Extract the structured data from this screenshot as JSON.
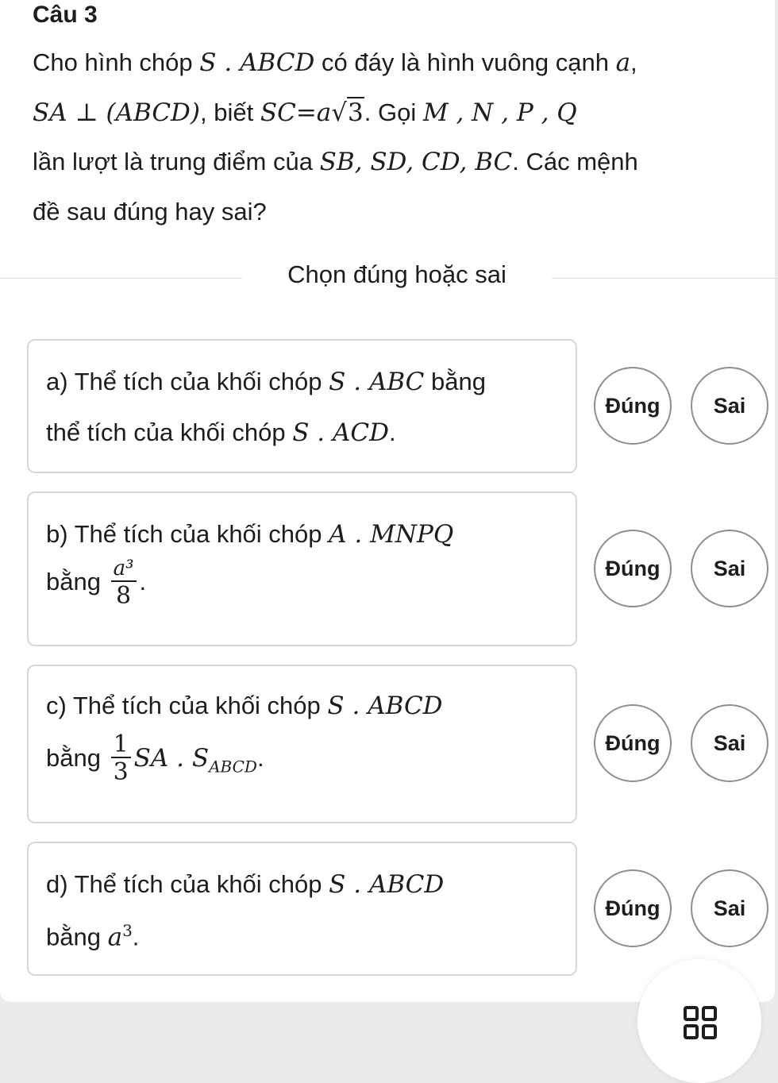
{
  "question": {
    "title": "Câu 3",
    "t_cho": "Cho hình chóp ",
    "t_pyr": "S . ABCD",
    "t_base": " có đáy là hình vuông cạnh ",
    "t_a": "a",
    "t_comma": ",",
    "t_sa": "SA",
    "t_perp": " ⊥ ",
    "t_plane": "(ABCD)",
    "t_biet": ", biết ",
    "t_sc": "SC",
    "t_eq": "=",
    "t_a2": "a",
    "t_sqrt": "√",
    "t_three": "3",
    "t_goi": ". Gọi ",
    "t_points": "M , N , P , Q",
    "t_lan": "lần lượt là trung điểm của ",
    "t_edges": "SB, SD, CD, BC",
    "t_cac": ". Các mệnh",
    "t_de": "đề sau đúng hay sai?"
  },
  "section_label": "Chọn đúng hoặc sai",
  "statements": [
    {
      "l1_text": "a) Thể tích của khối chóp ",
      "l1_math": "S . ABC",
      "l1_tail": " bằng",
      "l2_text": "thể tích của khối chóp ",
      "l2_math": "S . ACD",
      "l2_tail": ".",
      "true_label": "Đúng",
      "false_label": "Sai"
    },
    {
      "l1_text": "b) Thể tích của khối chóp ",
      "l1_math": "A . MNPQ",
      "l2_text": "bằng ",
      "frac_num": "a³",
      "frac_den": "8",
      "l2_tail": ".",
      "true_label": "Đúng",
      "false_label": "Sai"
    },
    {
      "l1_text": "c) Thể tích của khối chóp ",
      "l1_math": "S . ABCD",
      "l2_text": "bằng ",
      "frac_num": "1",
      "frac_den": "3",
      "l2_math": "SA . S",
      "l2_sub": "ABCD",
      "l2_tail": ".",
      "true_label": "Đúng",
      "false_label": "Sai"
    },
    {
      "l1_text": "d) Thể tích của khối chóp ",
      "l1_math": "S . ABCD",
      "l2_text": "bằng ",
      "l2_math": "a",
      "l2_sup": "3",
      "l2_tail": ".",
      "true_label": "Đúng",
      "false_label": "Sai"
    }
  ],
  "fab": {
    "icon": "grid-icon"
  }
}
